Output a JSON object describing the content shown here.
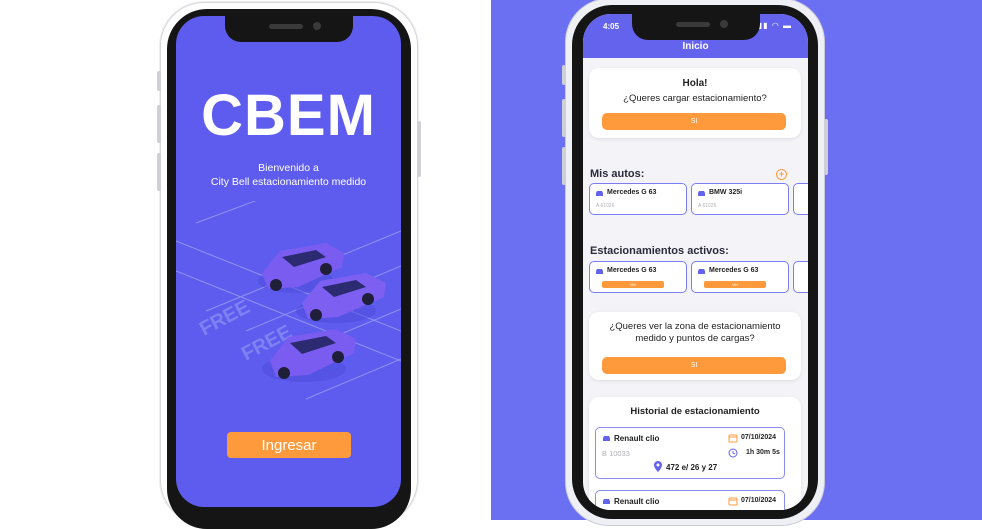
{
  "splash": {
    "brand": "CBEM",
    "welcome_line1": "Bienvenido a",
    "welcome_line2": "City Bell estacionamiento medido",
    "lot_labels": [
      "FREE",
      "FREE"
    ],
    "enter_button": "Ingresar"
  },
  "home": {
    "status_time": "4:05",
    "status_icons": "▮▮▮ ◠ ▬",
    "header_title": "Inicio",
    "greeting": {
      "title": "Hola!",
      "question": "¿Queres cargar estacionamiento?",
      "button": "SI"
    },
    "my_cars": {
      "label": "Mis autos:",
      "items": [
        {
          "name": "Mercedes G 63",
          "plate": "A 61026"
        },
        {
          "name": "BMW 325i",
          "plate": "A 61026"
        }
      ]
    },
    "active_parkings": {
      "label": "Estacionamientos activos:",
      "items": [
        {
          "name": "Mercedes G 63",
          "button": "Ver"
        },
        {
          "name": "Mercedes G 63",
          "button": "Ver"
        }
      ]
    },
    "zone": {
      "question_line1": "¿Queres ver la zona de estacionamiento",
      "question_line2": "medido y puntos de cargas?",
      "button": "SI"
    },
    "history": {
      "title": "Historial de estacionamiento",
      "items": [
        {
          "car": "Renault clio",
          "plate": "B 10033",
          "date": "07/10/2024",
          "duration": "1h 30m 5s",
          "address": "472 e/ 26 y 27"
        },
        {
          "car": "Renault clio",
          "date": "07/10/2024"
        }
      ]
    }
  },
  "colors": {
    "primary": "#5D5CEF",
    "background_right": "#6B6FF2",
    "accent": "#FF9A3C",
    "chip_border": "#7B7EF0"
  }
}
